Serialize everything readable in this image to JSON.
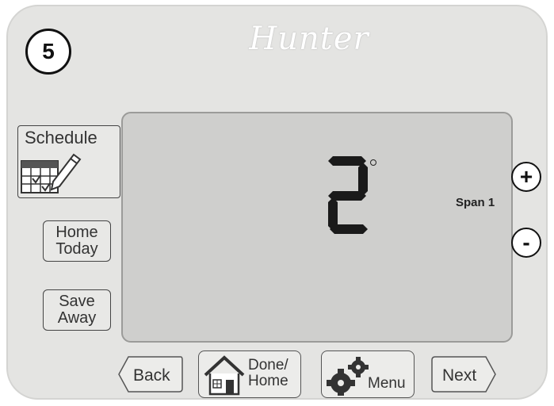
{
  "step_number": "5",
  "brand": "Hunter",
  "display": {
    "value": "2",
    "degree_symbol": "°",
    "mode_label": "Span 1"
  },
  "buttons": {
    "schedule": "Schedule",
    "home_today_1": "Home",
    "home_today_2": "Today",
    "save_away_1": "Save",
    "save_away_2": "Away",
    "plus": "+",
    "minus": "-",
    "back": "Back",
    "done_home_1": "Done/",
    "done_home_2": "Home",
    "menu": "Menu",
    "next": "Next"
  }
}
